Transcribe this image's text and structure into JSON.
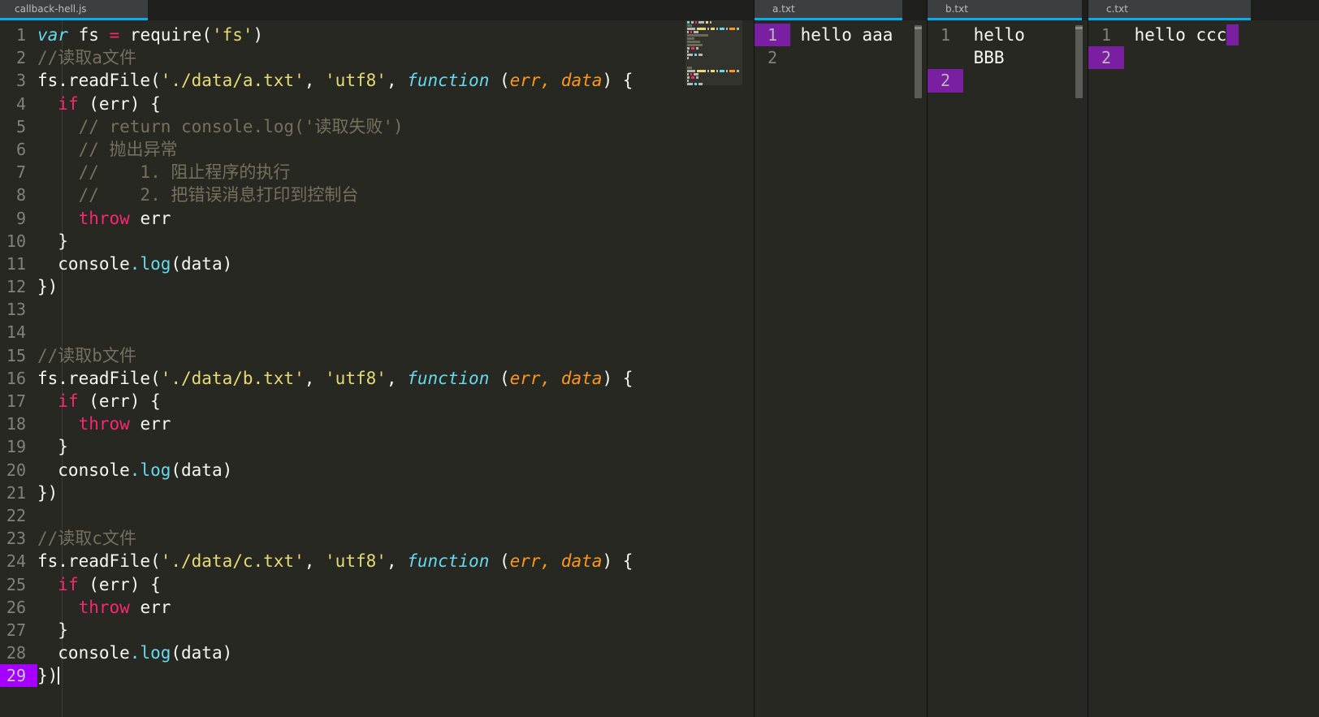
{
  "editor": {
    "tab_label": "callback-hell.js",
    "cursor_line": 29,
    "lines": [
      {
        "n": "1",
        "tokens": [
          {
            "t": "var ",
            "c": "kw"
          },
          {
            "t": "fs ",
            "c": "plain"
          },
          {
            "t": "=",
            "c": "op"
          },
          {
            "t": " require(",
            "c": "plain"
          },
          {
            "t": "'fs'",
            "c": "str"
          },
          {
            "t": ")",
            "c": "plain"
          }
        ]
      },
      {
        "n": "2",
        "tokens": [
          {
            "t": "//读取a文件",
            "c": "cmt"
          }
        ]
      },
      {
        "n": "3",
        "tokens": [
          {
            "t": "fs.readFile(",
            "c": "plain"
          },
          {
            "t": "'./data/a.txt'",
            "c": "str"
          },
          {
            "t": ", ",
            "c": "plain"
          },
          {
            "t": "'utf8'",
            "c": "str"
          },
          {
            "t": ", ",
            "c": "plain"
          },
          {
            "t": "function",
            "c": "kw"
          },
          {
            "t": " (",
            "c": "plain"
          },
          {
            "t": "err, data",
            "c": "param"
          },
          {
            "t": ") {",
            "c": "plain"
          }
        ]
      },
      {
        "n": "4",
        "tokens": [
          {
            "t": "  ",
            "c": "plain"
          },
          {
            "t": "if",
            "c": "red"
          },
          {
            "t": " (err) {",
            "c": "plain"
          }
        ]
      },
      {
        "n": "5",
        "tokens": [
          {
            "t": "    // return console.log('读取失败')",
            "c": "cmt"
          }
        ]
      },
      {
        "n": "6",
        "tokens": [
          {
            "t": "    // 抛出异常",
            "c": "cmt"
          }
        ]
      },
      {
        "n": "7",
        "tokens": [
          {
            "t": "    //    1. 阻止程序的执行",
            "c": "cmt"
          }
        ]
      },
      {
        "n": "8",
        "tokens": [
          {
            "t": "    //    2. 把错误消息打印到控制台",
            "c": "cmt"
          }
        ]
      },
      {
        "n": "9",
        "tokens": [
          {
            "t": "    ",
            "c": "plain"
          },
          {
            "t": "throw",
            "c": "red"
          },
          {
            "t": " err",
            "c": "plain"
          }
        ]
      },
      {
        "n": "10",
        "tokens": [
          {
            "t": "  }",
            "c": "plain"
          }
        ]
      },
      {
        "n": "11",
        "tokens": [
          {
            "t": "  console",
            "c": "plain"
          },
          {
            "t": ".log",
            "c": "fn"
          },
          {
            "t": "(data)",
            "c": "plain"
          }
        ]
      },
      {
        "n": "12",
        "tokens": [
          {
            "t": "})",
            "c": "plain"
          }
        ]
      },
      {
        "n": "13",
        "tokens": []
      },
      {
        "n": "14",
        "tokens": []
      },
      {
        "n": "15",
        "tokens": [
          {
            "t": "//读取b文件",
            "c": "cmt"
          }
        ]
      },
      {
        "n": "16",
        "tokens": [
          {
            "t": "fs.readFile(",
            "c": "plain"
          },
          {
            "t": "'./data/b.txt'",
            "c": "str"
          },
          {
            "t": ", ",
            "c": "plain"
          },
          {
            "t": "'utf8'",
            "c": "str"
          },
          {
            "t": ", ",
            "c": "plain"
          },
          {
            "t": "function",
            "c": "kw"
          },
          {
            "t": " (",
            "c": "plain"
          },
          {
            "t": "err, data",
            "c": "param"
          },
          {
            "t": ") {",
            "c": "plain"
          }
        ]
      },
      {
        "n": "17",
        "tokens": [
          {
            "t": "  ",
            "c": "plain"
          },
          {
            "t": "if",
            "c": "red"
          },
          {
            "t": " (err) {",
            "c": "plain"
          }
        ]
      },
      {
        "n": "18",
        "tokens": [
          {
            "t": "    ",
            "c": "plain"
          },
          {
            "t": "throw",
            "c": "red"
          },
          {
            "t": " err",
            "c": "plain"
          }
        ]
      },
      {
        "n": "19",
        "tokens": [
          {
            "t": "  }",
            "c": "plain"
          }
        ]
      },
      {
        "n": "20",
        "tokens": [
          {
            "t": "  console",
            "c": "plain"
          },
          {
            "t": ".log",
            "c": "fn"
          },
          {
            "t": "(data)",
            "c": "plain"
          }
        ]
      },
      {
        "n": "21",
        "tokens": [
          {
            "t": "})",
            "c": "plain"
          }
        ]
      },
      {
        "n": "22",
        "tokens": []
      },
      {
        "n": "23",
        "tokens": [
          {
            "t": "//读取c文件",
            "c": "cmt"
          }
        ]
      },
      {
        "n": "24",
        "tokens": [
          {
            "t": "fs.readFile(",
            "c": "plain"
          },
          {
            "t": "'./data/c.txt'",
            "c": "str"
          },
          {
            "t": ", ",
            "c": "plain"
          },
          {
            "t": "'utf8'",
            "c": "str"
          },
          {
            "t": ", ",
            "c": "plain"
          },
          {
            "t": "function",
            "c": "kw"
          },
          {
            "t": " (",
            "c": "plain"
          },
          {
            "t": "err, data",
            "c": "param"
          },
          {
            "t": ") {",
            "c": "plain"
          }
        ]
      },
      {
        "n": "25",
        "tokens": [
          {
            "t": "  ",
            "c": "plain"
          },
          {
            "t": "if",
            "c": "red"
          },
          {
            "t": " (err) {",
            "c": "plain"
          }
        ]
      },
      {
        "n": "26",
        "tokens": [
          {
            "t": "    ",
            "c": "plain"
          },
          {
            "t": "throw",
            "c": "red"
          },
          {
            "t": " err",
            "c": "plain"
          }
        ]
      },
      {
        "n": "27",
        "tokens": [
          {
            "t": "  }",
            "c": "plain"
          }
        ]
      },
      {
        "n": "28",
        "tokens": [
          {
            "t": "  console",
            "c": "plain"
          },
          {
            "t": ".log",
            "c": "fn"
          },
          {
            "t": "(data)",
            "c": "plain"
          }
        ]
      },
      {
        "n": "29",
        "tokens": [
          {
            "t": "})",
            "c": "plain"
          }
        ],
        "caret": true
      }
    ]
  },
  "file_panels": [
    {
      "id": "a",
      "tab_label": "a.txt",
      "rows": [
        {
          "n": "1",
          "highlight": true,
          "text": "hello aaa",
          "cursor": false
        },
        {
          "n": "2",
          "highlight": false,
          "text": "",
          "cursor": false
        }
      ]
    },
    {
      "id": "b",
      "tab_label": "b.txt",
      "rows": [
        {
          "n": "1",
          "highlight": false,
          "text": "hello",
          "cursor": false
        },
        {
          "n": "",
          "highlight": false,
          "text": "BBB",
          "cursor": false
        },
        {
          "n": "2",
          "highlight": true,
          "text": "",
          "cursor": false
        }
      ]
    },
    {
      "id": "c",
      "tab_label": "c.txt",
      "rows": [
        {
          "n": "1",
          "highlight": false,
          "text": "hello ccc",
          "cursor": true
        },
        {
          "n": "2",
          "highlight": true,
          "text": "",
          "cursor": false
        }
      ]
    }
  ],
  "colors": {
    "background": "#272822",
    "tab_bar": "#1e1f1c",
    "tab_active": "#3c3f41",
    "accent_underline": "#00b0f0",
    "line_highlight_main": "#a500ff",
    "line_highlight_txt": "#7a1fa2",
    "line_number": "#80837a",
    "text": "#f8f8f2",
    "comment": "#75715e",
    "string": "#e6db74",
    "keyword": "#66d9ef",
    "operator": "#f92672",
    "parameter": "#fd971f"
  }
}
